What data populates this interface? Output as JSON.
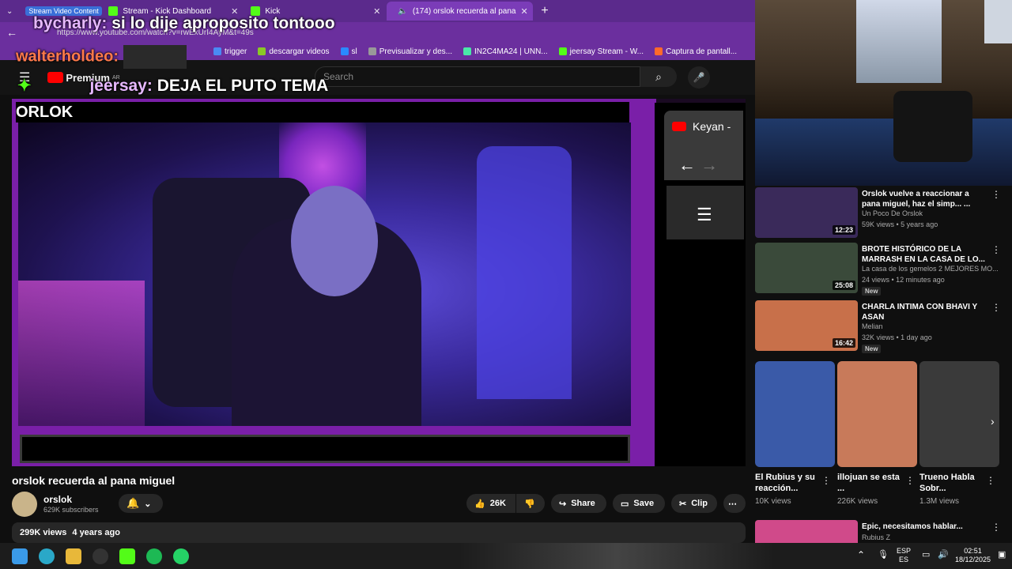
{
  "browser": {
    "tabs": [
      {
        "label": "Stream Video Content",
        "selected_group": true
      },
      {
        "label": "Stream - Kick Dashboard"
      },
      {
        "label": "Kick"
      },
      {
        "label": "(174) orslok recuerda al pana",
        "active": true
      }
    ],
    "url": "https://www.youtube.com/watch?v=rwExUrI4AyM&t=49s",
    "bookmarks": [
      "trigger",
      "descargar videos",
      "sl",
      "Previsualizar y des...",
      "IN2C4MA24 | UNN...",
      "jeersay Stream - W...",
      "Captura de pantall..."
    ]
  },
  "chat_overlay": [
    {
      "user": "bycharly:",
      "message": "si lo dije aproposito tontooo"
    },
    {
      "user": "walterholdeo:",
      "message": ""
    },
    {
      "user": "jeersay:",
      "message": "DEJA EL PUTO TEMA"
    }
  ],
  "youtube": {
    "logo": "Premium",
    "region": "AR",
    "search_placeholder": "Search"
  },
  "video": {
    "frame_label": "ORLOK",
    "side_tab": "Keyan -",
    "title": "orslok recuerda al pana miguel",
    "channel": "orslok",
    "subscribers": "629K subscribers",
    "likes": "26K",
    "share": "Share",
    "save": "Save",
    "clip": "Clip",
    "views": "299K views",
    "age": "4 years ago"
  },
  "recommendations": [
    {
      "title": "Orslok vuelve a reaccionar a pana miguel, haz el simp... ...",
      "channel": "Un Poco De Orslok",
      "meta": "59K views • 5 years ago",
      "duration": "12:23",
      "new": false,
      "thumb": "#3a2a5a"
    },
    {
      "title": "BROTE HISTÓRICO DE LA MARRASH EN LA CASA DE LO...",
      "channel": "La casa de los gemelos 2 MEJORES MO...",
      "meta": "24 views • 12 minutes ago",
      "duration": "25:08",
      "new": true,
      "thumb": "#3a4a3a"
    },
    {
      "title": "CHARLA INTIMA CON BHAVI Y ASAN",
      "channel": "Melian",
      "meta": "32K views • 1 day ago",
      "duration": "16:42",
      "new": true,
      "thumb": "#c8704a"
    },
    {
      "title": "Epic, necesitamos hablar...",
      "channel": "Rubius Z",
      "meta": "",
      "duration": "",
      "new": false,
      "thumb": "#d04a8a"
    }
  ],
  "new_badge": "New",
  "shorts": [
    {
      "title": "El Rubius y su reacción...",
      "views": "10K views",
      "color": "#3a5aa8"
    },
    {
      "title": "illojuan se esta ...",
      "views": "226K views",
      "color": "#c87a5a"
    },
    {
      "title": "Trueno Habla Sobr...",
      "views": "1.3M views",
      "color": "#3a3a3a"
    }
  ],
  "taskbar": {
    "lang": "ESP",
    "lang_sub": "ES",
    "time": "02:51",
    "date": "18/12/2025"
  }
}
